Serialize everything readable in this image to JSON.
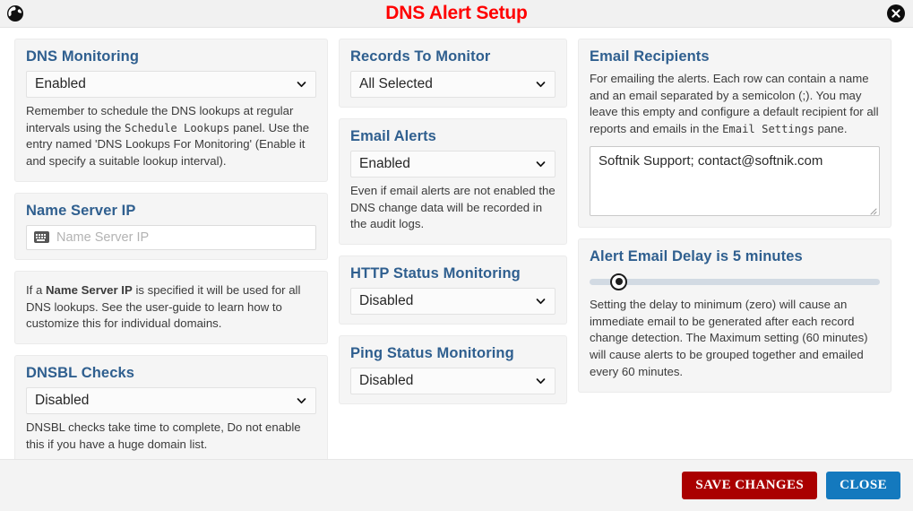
{
  "titlebar": {
    "icon": "globe-icon",
    "title": "DNS Alert Setup",
    "close_icon": "close-circle-icon"
  },
  "panels": {
    "dns_monitoring": {
      "title": "DNS Monitoring",
      "select_value": "Enabled",
      "desc_1": "Remember to schedule the DNS lookups at regular intervals using the ",
      "desc_mono": "Schedule  Lookups",
      "desc_2": " panel. Use the entry named 'DNS Lookups For Monitoring' (Enable it and specify a suitable lookup interval)."
    },
    "name_server_ip": {
      "title": "Name Server IP",
      "input_placeholder": "Name Server IP",
      "input_value": "",
      "input_icon": "keyboard-icon"
    },
    "name_server_ip_note": {
      "text_1": "If a ",
      "bold": "Name Server IP",
      "text_2": " is specified it will be used for all DNS lookups. See the user-guide to learn how to customize this for individual domains."
    },
    "dnsbl_checks": {
      "title": "DNSBL Checks",
      "select_value": "Disabled",
      "desc": "DNSBL checks take time to complete, Do not enable this if you have a huge domain list."
    },
    "records_to_monitor": {
      "title": "Records To Monitor",
      "select_value": "All Selected"
    },
    "email_alerts": {
      "title": "Email Alerts",
      "select_value": "Enabled",
      "desc": "Even if email alerts are not enabled the DNS change data will be recorded in the audit logs."
    },
    "http_status_monitoring": {
      "title": "HTTP Status Monitoring",
      "select_value": "Disabled"
    },
    "ping_status_monitoring": {
      "title": "Ping Status Monitoring",
      "select_value": "Disabled"
    },
    "email_recipients": {
      "title": "Email Recipients",
      "desc_1": "For emailing the alerts. Each row can contain a name and an email separated by a semicolon (;). You may leave this empty and configure a default recipient for all reports and emails in the ",
      "desc_mono": "Email Settings",
      "desc_2": " pane.",
      "textarea_value": "Softnik Support; contact@softnik.com"
    },
    "alert_email_delay": {
      "title": "Alert Email Delay is 5 minutes",
      "slider_value": 5,
      "slider_min": 0,
      "slider_max": 60,
      "slider_percent": 10,
      "desc": "Setting the delay to minimum (zero) will cause an immediate email to be generated after each record change detection. The Maximum setting (60 minutes) will cause alerts to be grouped together and emailed every 60 minutes."
    }
  },
  "footer": {
    "save_label": "SAVE CHANGES",
    "close_label": "CLOSE"
  },
  "colors": {
    "title_red": "#ff0000",
    "heading_blue": "#2f5f8f",
    "save_red": "#aa0000",
    "close_blue": "#1479be",
    "slider_track": "#d2dae3"
  }
}
